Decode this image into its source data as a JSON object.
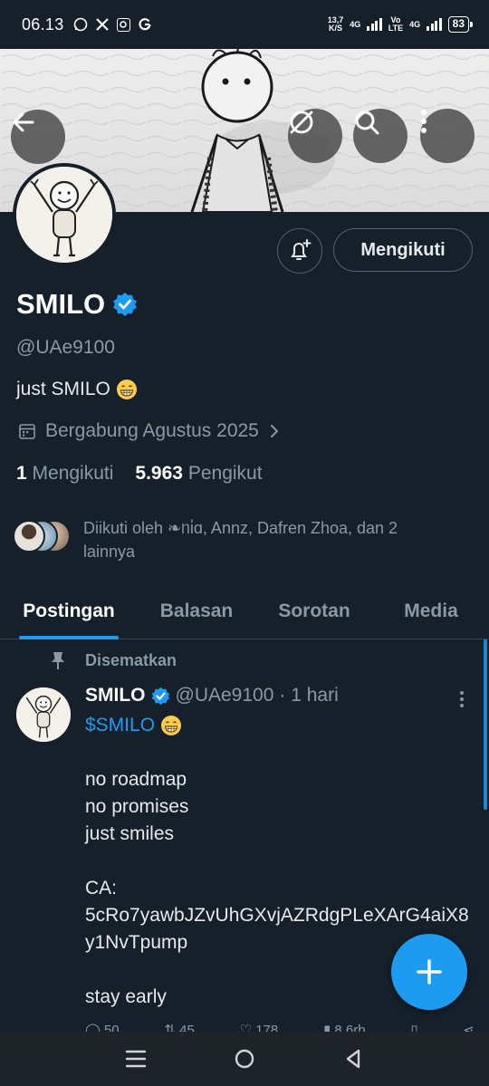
{
  "status_bar": {
    "time": "06.13",
    "net_speed_top": "13,7",
    "net_speed_bottom": "K/S",
    "net_type_1": "4G",
    "volte_top": "Vo",
    "volte_bottom": "LTE",
    "net_type_2": "4G",
    "battery": "83"
  },
  "profile": {
    "name": "SMILO",
    "handle": "@UAe9100",
    "bio": "just SMILO",
    "joined": "Bergabung Agustus 2025",
    "following_count": "1",
    "following_label": "Mengikuti",
    "followers_count": "5.963",
    "followers_label": "Pengikut",
    "followed_by": "Diikuti oleh ❧ᥒi̇ɑ, Annz, Dafren Zhoa, dan 2 lainnya",
    "follow_button": "Mengikuti"
  },
  "tabs": [
    {
      "label": "Postingan",
      "active": true
    },
    {
      "label": "Balasan",
      "active": false
    },
    {
      "label": "Sorotan",
      "active": false
    },
    {
      "label": "Media",
      "active": false
    }
  ],
  "post": {
    "pinned_label": "Disematkan",
    "author": "SMILO",
    "handle": "@UAe9100",
    "time": "· 1 hari",
    "cashtag": "$SMILO",
    "lines": [
      "",
      "no roadmap",
      "no promises",
      "just smiles",
      "",
      "CA:",
      "5cRo7yawbJZvUhGXvjAZRdgPLeXArG4aiX8y1NvTpump",
      "",
      "stay early"
    ],
    "replies": "50",
    "reposts": "45",
    "likes": "178",
    "views": "8,6rb"
  },
  "colors": {
    "background": "#15202b",
    "accent": "#1d9bf0",
    "muted": "#8b98a5",
    "verified": "#1d9bf0"
  },
  "icons": [
    "back-arrow-icon",
    "explore-icon",
    "search-icon",
    "more-icon",
    "bell-plus-icon",
    "verified-badge-icon",
    "calendar-icon",
    "chevron-right-icon",
    "pin-icon",
    "plus-icon",
    "menu-icon",
    "home-circle-icon",
    "back-triangle-icon"
  ]
}
